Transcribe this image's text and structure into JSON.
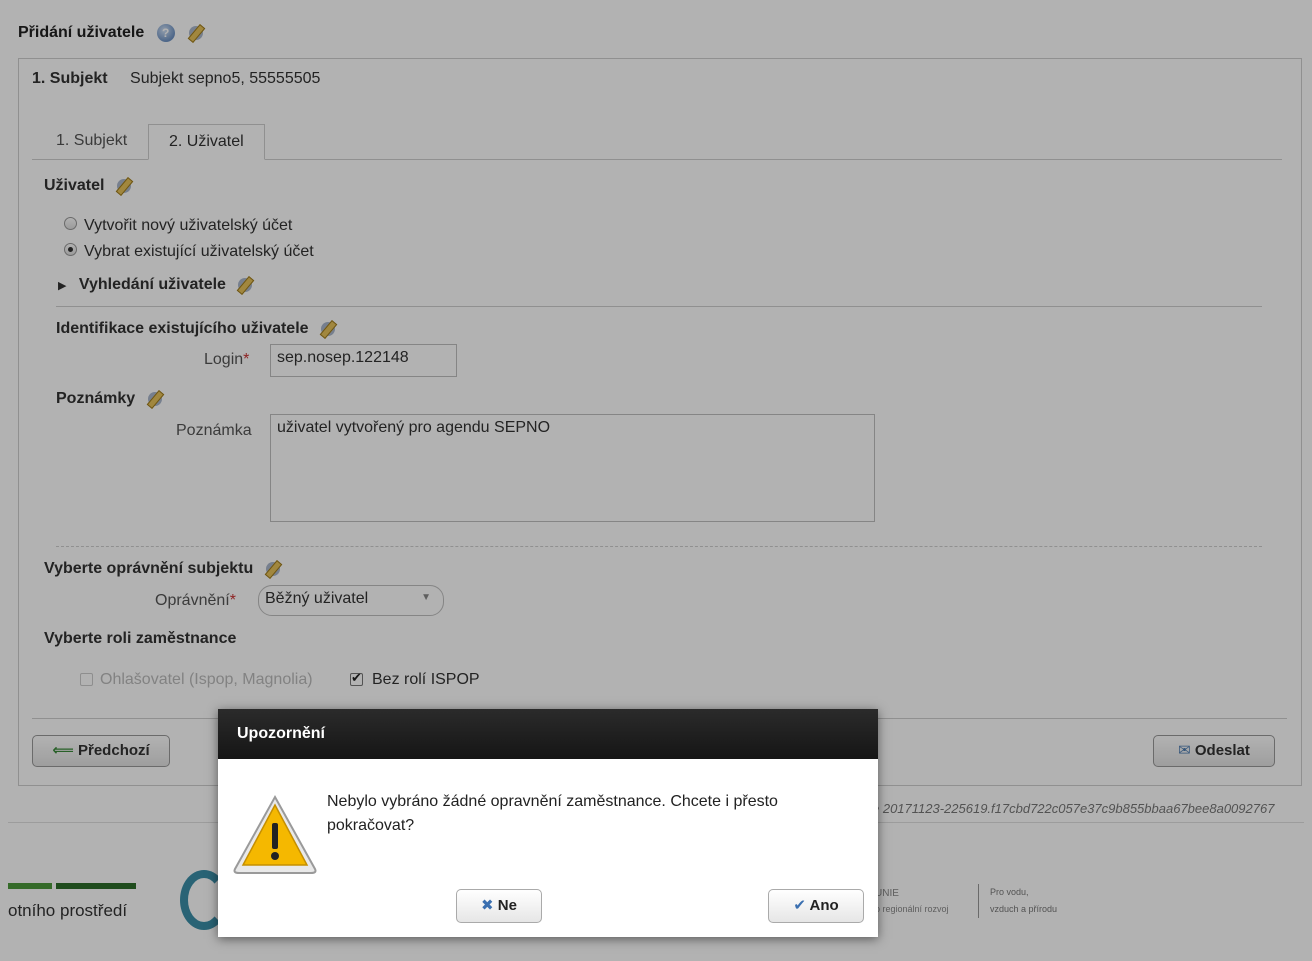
{
  "panel": {
    "title": "Přidání uživatele"
  },
  "subject_header": {
    "label": "1. Subjekt",
    "value": "Subjekt sepno5, 55555505"
  },
  "tabs": [
    {
      "label": "1. Subjekt"
    },
    {
      "label": "2. Uživatel"
    }
  ],
  "user_section": {
    "title": "Uživatel",
    "radio_new": "Vytvořit nový uživatelský účet",
    "radio_existing": "Vybrat existující uživatelský účet",
    "search_toggle": "Vyhledání uživatele"
  },
  "identification": {
    "title": "Identifikace existujícího uživatele",
    "login_label": "Login",
    "required_mark": "*",
    "login_value": "sep.nosep.122148"
  },
  "notes": {
    "title": "Poznámky",
    "note_label": "Poznámka",
    "note_value": "uživatel vytvořený pro agendu SEPNO"
  },
  "permissions": {
    "title": "Vyberte oprávnění subjektu",
    "label": "Oprávnění",
    "selected": "Běžný uživatel"
  },
  "roles": {
    "title": "Vyberte roli zaměstnance",
    "role1": "Ohlašovatel (Ispop, Magnolia)",
    "role2": "Bez rolí ISPOP",
    "role2_checked": true
  },
  "buttons": {
    "prev": "Předchozí",
    "send": "Odeslat"
  },
  "version": "e 20171123-225619.f17cbd722c057e37c9b855bbaa67bee8a0092767",
  "footer": {
    "left_text": "otního prostředí",
    "unie_text": "UNIE",
    "regional_text": "o regionální rozvoj",
    "slogan_line1": "Pro vodu,",
    "slogan_line2": "vzduch a přírodu"
  },
  "dialog": {
    "title": "Upozornění",
    "message": "Nebylo vybráno žádné opravnění zaměstnance. Chcete i přesto pokračovat?",
    "no_label": "Ne",
    "yes_label": "Ano"
  },
  "colors": {
    "overlay": "rgba(0,0,0,0.30)",
    "dialog_header": "#1e1e1e",
    "required": "#cc3333",
    "warning_yellow": "#f5b800"
  }
}
